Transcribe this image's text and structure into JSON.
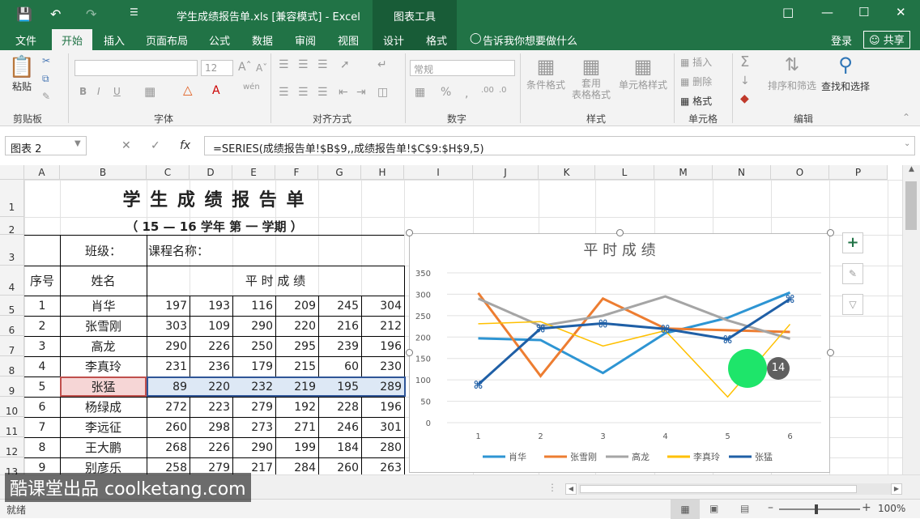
{
  "titlebar": {
    "title": "学生成绩报告单.xls  [兼容模式] - Excel",
    "tools_label": "图表工具",
    "save_icon": "save-icon",
    "undo_icon": "undo-icon",
    "redo_icon": "redo-icon"
  },
  "tabs": [
    "文件",
    "开始",
    "插入",
    "页面布局",
    "公式",
    "数据",
    "审阅",
    "视图",
    "设计",
    "格式"
  ],
  "tell_me": "告诉我你想要做什么",
  "login": "登录",
  "share": "共享",
  "ribbon": {
    "paste": "粘贴",
    "groups": [
      "剪贴板",
      "字体",
      "对齐方式",
      "数字",
      "样式",
      "单元格",
      "编辑"
    ],
    "font_size": "12",
    "number_format": "常规",
    "cond_format": "条件格式",
    "table_format": "套用\n表格格式",
    "cell_style": "单元格样式",
    "insert": "插入",
    "delete": "删除",
    "format": "格式",
    "sort_filter": "排序和筛选",
    "find_select": "查找和选择"
  },
  "namebox": "图表 2",
  "formula": "=SERIES(成绩报告单!$B$9,,成绩报告单!$C$9:$H$9,5)",
  "columns": [
    "A",
    "B",
    "C",
    "D",
    "E",
    "F",
    "G",
    "H",
    "I",
    "J",
    "K",
    "L",
    "M",
    "N",
    "O",
    "P"
  ],
  "rows": [
    "1",
    "2",
    "3",
    "4",
    "5",
    "6",
    "7",
    "8",
    "9",
    "10",
    "11",
    "12",
    "13"
  ],
  "sheet": {
    "title": "学 生 成 绩 报 告 单",
    "subtitle": "（ 15 — 16    学年 第 一 学期 ）",
    "class_label": "班级：",
    "course_label": "课程名称：",
    "col_no": "序号",
    "col_name": "姓名",
    "col_scores": "平 时 成 绩",
    "students": [
      {
        "no": "1",
        "name": "肖华",
        "scores": [
          "197",
          "193",
          "116",
          "209",
          "245",
          "304"
        ]
      },
      {
        "no": "2",
        "name": "张雪刚",
        "scores": [
          "303",
          "109",
          "290",
          "220",
          "216",
          "212"
        ]
      },
      {
        "no": "3",
        "name": "高龙",
        "scores": [
          "290",
          "226",
          "250",
          "295",
          "239",
          "196"
        ]
      },
      {
        "no": "4",
        "name": "李真玲",
        "scores": [
          "231",
          "236",
          "179",
          "215",
          "60",
          "230"
        ]
      },
      {
        "no": "5",
        "name": "张猛",
        "scores": [
          "89",
          "220",
          "232",
          "219",
          "195",
          "289"
        ]
      },
      {
        "no": "6",
        "name": "杨绿成",
        "scores": [
          "272",
          "223",
          "279",
          "192",
          "228",
          "196"
        ]
      },
      {
        "no": "7",
        "name": "李远征",
        "scores": [
          "260",
          "298",
          "273",
          "271",
          "246",
          "301"
        ]
      },
      {
        "no": "8",
        "name": "王大鹏",
        "scores": [
          "268",
          "226",
          "290",
          "199",
          "184",
          "280"
        ]
      },
      {
        "no": "9",
        "name": "别彦乐",
        "scores": [
          "258",
          "279",
          "217",
          "284",
          "260",
          "263"
        ]
      }
    ]
  },
  "chart_data": {
    "type": "line",
    "title": "平时成绩",
    "x": [
      1,
      2,
      3,
      4,
      5,
      6
    ],
    "ylim": [
      0,
      350
    ],
    "yticks": [
      0,
      50,
      100,
      150,
      200,
      250,
      300,
      350
    ],
    "grid": true,
    "legend": "bottom",
    "series": [
      {
        "name": "肖华",
        "color": "#2e95d3",
        "values": [
          197,
          193,
          116,
          209,
          245,
          304
        ]
      },
      {
        "name": "张雪刚",
        "color": "#ed7d31",
        "values": [
          303,
          109,
          290,
          220,
          216,
          212
        ]
      },
      {
        "name": "高龙",
        "color": "#a5a5a5",
        "values": [
          290,
          226,
          250,
          295,
          239,
          196
        ]
      },
      {
        "name": "李真玲",
        "color": "#ffc000",
        "values": [
          231,
          236,
          179,
          215,
          60,
          230
        ]
      },
      {
        "name": "张猛",
        "color": "#1f5fa6",
        "values": [
          89,
          220,
          232,
          219,
          195,
          289
        ]
      }
    ]
  },
  "click_badge": "14",
  "status": "就绪",
  "zoom": "100%",
  "watermark": "酷课堂出品 coolketang.com"
}
